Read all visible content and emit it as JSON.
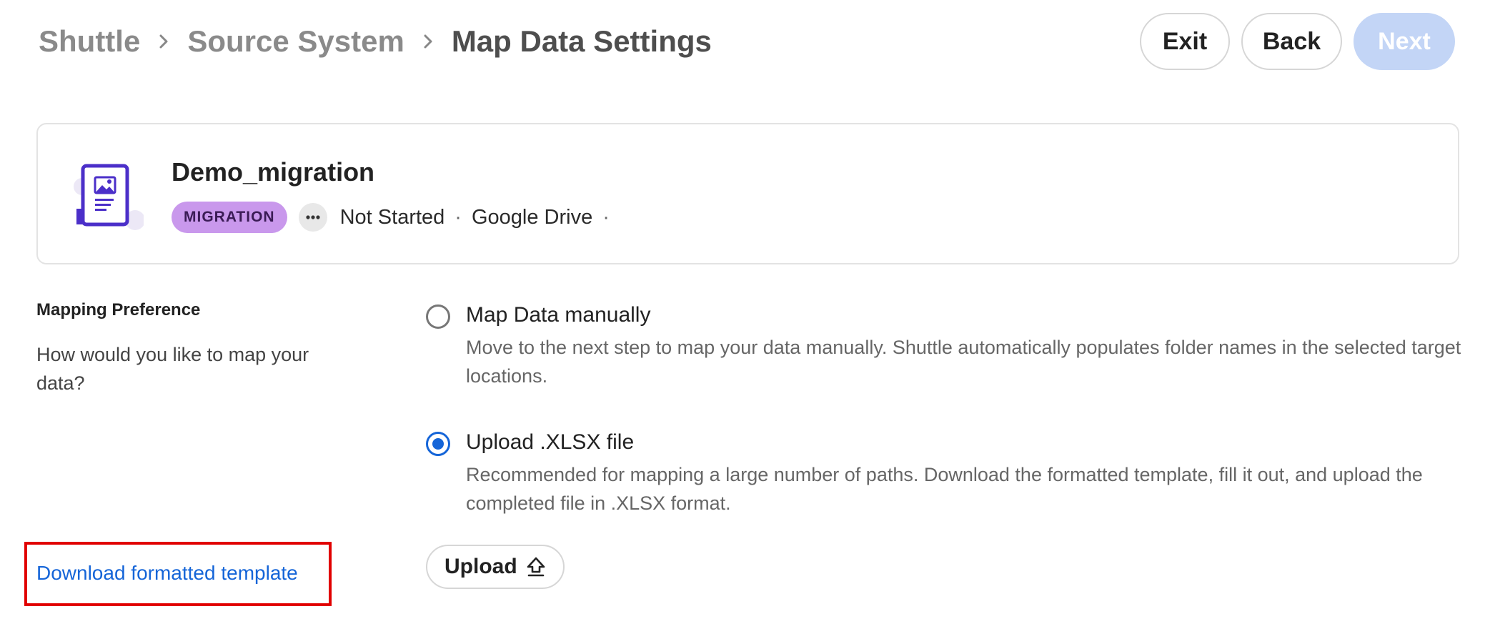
{
  "breadcrumb": {
    "items": [
      "Shuttle",
      "Source System",
      "Map Data Settings"
    ]
  },
  "header_actions": {
    "exit_label": "Exit",
    "back_label": "Back",
    "next_label": "Next"
  },
  "migration_card": {
    "title": "Demo_migration",
    "tag": "MIGRATION",
    "status": "Not Started",
    "source": "Google Drive",
    "separator": "·"
  },
  "mapping_preference": {
    "title": "Mapping Preference",
    "description": "How would you like to map your data?"
  },
  "options": [
    {
      "title": "Map Data manually",
      "description": "Move to the next step to map your data manually. Shuttle automatically populates folder names in the selected target locations.",
      "selected": false
    },
    {
      "title": "Upload .XLSX file",
      "description": "Recommended for mapping a large number of paths. Download the formatted template, fill it out, and upload the completed file in .XLSX format.",
      "selected": true
    }
  ],
  "upload": {
    "label": "Upload"
  },
  "download_template": {
    "label": "Download formatted template"
  },
  "colors": {
    "accent_blue": "#1565d8",
    "next_disabled": "#c3d5f6",
    "tag_purple": "#c998ec",
    "highlight_red": "#e10000"
  }
}
